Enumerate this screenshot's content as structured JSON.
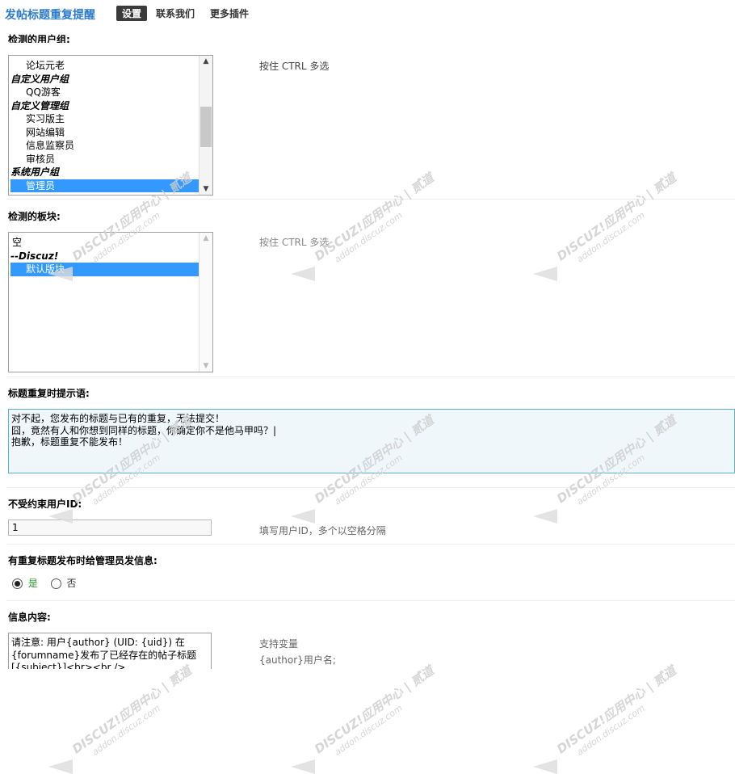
{
  "header": {
    "title": "发帖标题重复提醒",
    "tabs": [
      {
        "label": "设置",
        "active": true
      },
      {
        "label": "联系我们",
        "active": false
      },
      {
        "label": "更多插件",
        "active": false
      }
    ]
  },
  "user_groups": {
    "label": "检测的用户组:",
    "tip": "按住 CTRL 多选",
    "options": [
      {
        "text": "论坛元老",
        "kind": "item"
      },
      {
        "text": "自定义用户组",
        "kind": "group"
      },
      {
        "text": "QQ游客",
        "kind": "item"
      },
      {
        "text": "自定义管理组",
        "kind": "group"
      },
      {
        "text": "实习版主",
        "kind": "item"
      },
      {
        "text": "网站编辑",
        "kind": "item"
      },
      {
        "text": "信息监察员",
        "kind": "item"
      },
      {
        "text": "审核员",
        "kind": "item"
      },
      {
        "text": "系统用户组",
        "kind": "group"
      },
      {
        "text": "管理员",
        "kind": "selected"
      }
    ]
  },
  "forums": {
    "label": "检测的板块:",
    "tip": "按住 CTRL 多选",
    "options": [
      {
        "text": "空",
        "kind": "plain"
      },
      {
        "text": "--Discuz!",
        "kind": "group"
      },
      {
        "text": "默认版块",
        "kind": "selected"
      }
    ]
  },
  "repeat_message": {
    "label": "标题重复时提示语:",
    "lines": [
      "对不起，您发布的标题与已有的重复，无法提交！",
      "囧，竟然有人和你想到同样的标题，你确定你不是他马甲吗？|",
      "抱歉，标题重复不能发布！"
    ]
  },
  "exempt_uid": {
    "label": "不受约束用户ID:",
    "value": "1",
    "tip": "填写用户ID，多个以空格分隔"
  },
  "notify_admin": {
    "label": "有重复标题发布时给管理员发信息:",
    "yes": "是",
    "no": "否",
    "selected": "yes"
  },
  "message_content": {
    "label": "信息内容:",
    "lines": [
      "请注意: 用户{author} (UID: {uid}) 在",
      "{forumname}发布了已经存在的帖子标题",
      "[{subject}]<br><br />"
    ],
    "tip_title": "支持变量",
    "tip_var": "{author}用户名;"
  },
  "watermark": {
    "brand": "DISCUZ!应用中心 | 贰道",
    "domain": "addon.discuz.com"
  },
  "colors": {
    "title": "#2b7acd",
    "selected": "#3399ff",
    "radio_yes": "#2a9a2a"
  }
}
